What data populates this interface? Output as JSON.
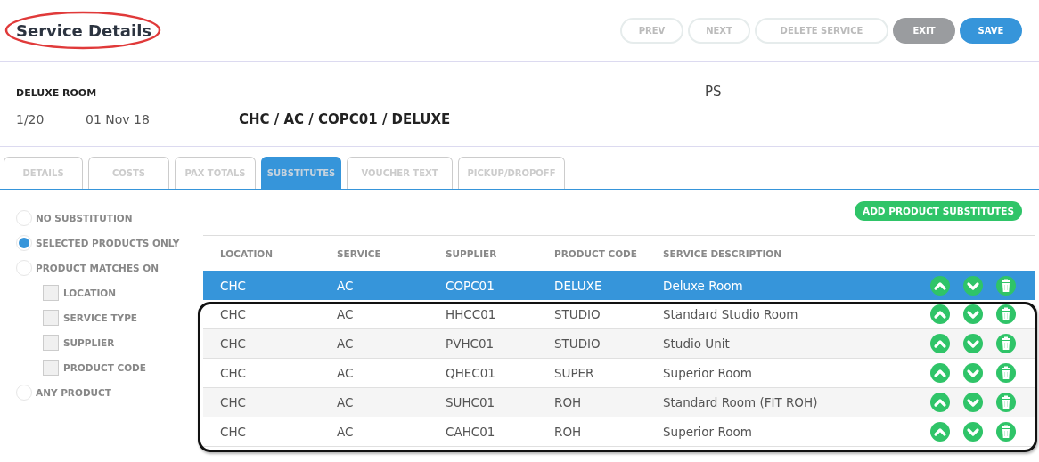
{
  "title": "Service Details",
  "title_circled": true,
  "buttons": [
    {
      "label": "PREV",
      "kind": "outline"
    },
    {
      "label": "NEXT",
      "kind": "outline"
    },
    {
      "label": "DELETE SERVICE",
      "kind": "outline"
    },
    {
      "label": "EXIT",
      "kind": "gray"
    },
    {
      "label": "SAVE",
      "kind": "primary"
    }
  ],
  "service": {
    "name": "DELUXE ROOM",
    "code": "PS",
    "index": "1/20",
    "date": "01 Nov 18",
    "path": "CHC / AC / COPC01 / DELUXE"
  },
  "tabs": [
    {
      "label": "DETAILS",
      "selected": false
    },
    {
      "label": "COSTS",
      "selected": false
    },
    {
      "label": "PAX TOTALS",
      "selected": false
    },
    {
      "label": "SUBSTITUTES",
      "selected": true
    },
    {
      "label": "VOUCHER TEXT",
      "selected": false
    },
    {
      "label": "PICKUP/DROPOFF",
      "selected": false
    }
  ],
  "options": [
    {
      "label": "NO SUBSTITUTION",
      "selected": false
    },
    {
      "label": "SELECTED PRODUCTS ONLY",
      "selected": true
    },
    {
      "label": "PRODUCT MATCHES ON",
      "selected": false,
      "children": [
        {
          "label": "LOCATION",
          "checked": false
        },
        {
          "label": "SERVICE TYPE",
          "checked": false
        },
        {
          "label": "SUPPLIER",
          "checked": false
        },
        {
          "label": "PRODUCT CODE",
          "checked": false
        }
      ]
    },
    {
      "label": "ANY PRODUCT",
      "selected": false
    }
  ],
  "add_button": "ADD PRODUCT SUBSTITUTES",
  "table": {
    "columns": [
      "LOCATION",
      "SERVICE",
      "SUPPLIER",
      "PRODUCT CODE",
      "SERVICE DESCRIPTION"
    ],
    "rows": [
      {
        "cells": [
          "CHC",
          "AC",
          "COPC01",
          "DELUXE",
          "Deluxe Room"
        ],
        "selected": true,
        "framed": false
      },
      {
        "cells": [
          "CHC",
          "AC",
          "HHCC01",
          "STUDIO",
          "Standard Studio Room"
        ],
        "selected": false,
        "framed": true
      },
      {
        "cells": [
          "CHC",
          "AC",
          "PVHC01",
          "STUDIO",
          "Studio Unit"
        ],
        "selected": false,
        "framed": true
      },
      {
        "cells": [
          "CHC",
          "AC",
          "QHEC01",
          "SUPER",
          "Superior Room"
        ],
        "selected": false,
        "framed": true
      },
      {
        "cells": [
          "CHC",
          "AC",
          "SUHC01",
          "ROH",
          "Standard Room (FIT ROH)"
        ],
        "selected": false,
        "framed": true
      },
      {
        "cells": [
          "CHC",
          "AC",
          "CAHC01",
          "ROH",
          "Superior Room"
        ],
        "selected": false,
        "framed": true
      }
    ]
  }
}
